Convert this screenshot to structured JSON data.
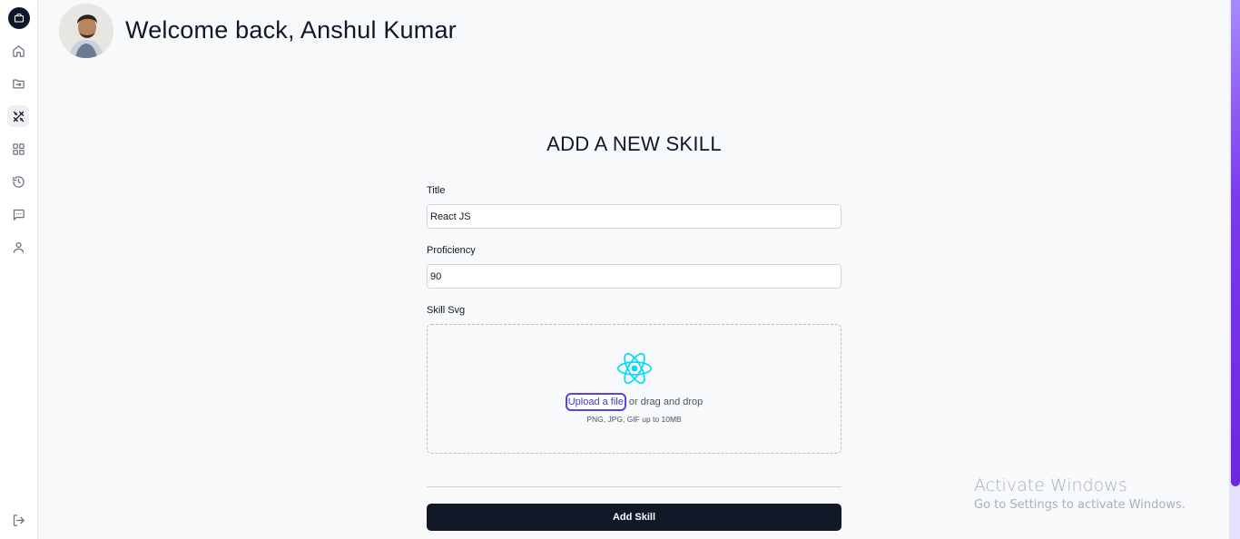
{
  "sidebar": {
    "logo_icon": "briefcase-icon",
    "items": [
      {
        "icon": "home-icon",
        "active": false
      },
      {
        "icon": "folder-icon",
        "active": false
      },
      {
        "icon": "tools-icon",
        "active": true
      },
      {
        "icon": "grid-icon",
        "active": false
      },
      {
        "icon": "history-icon",
        "active": false
      },
      {
        "icon": "message-icon",
        "active": false
      },
      {
        "icon": "user-icon",
        "active": false
      }
    ],
    "logout_icon": "logout-icon"
  },
  "header": {
    "welcome": "Welcome back, Anshul Kumar"
  },
  "form": {
    "heading": "ADD A NEW SKILL",
    "title_label": "Title",
    "title_value": "React JS",
    "proficiency_label": "Proficiency",
    "proficiency_value": "90",
    "svg_label": "Skill Svg",
    "upload_link": "Upload a file",
    "upload_rest": " or drag and drop",
    "upload_hint": "PNG, JPG, GIF up to 10MB",
    "preview_icon": "react-icon",
    "submit_label": "Add Skill"
  },
  "watermark": {
    "title": "Activate Windows",
    "subtitle": "Go to Settings to activate Windows."
  },
  "colors": {
    "primary": "#111827",
    "accent": "#4f46e5",
    "react": "#00d8ff",
    "scroll": "#7c3aed"
  }
}
